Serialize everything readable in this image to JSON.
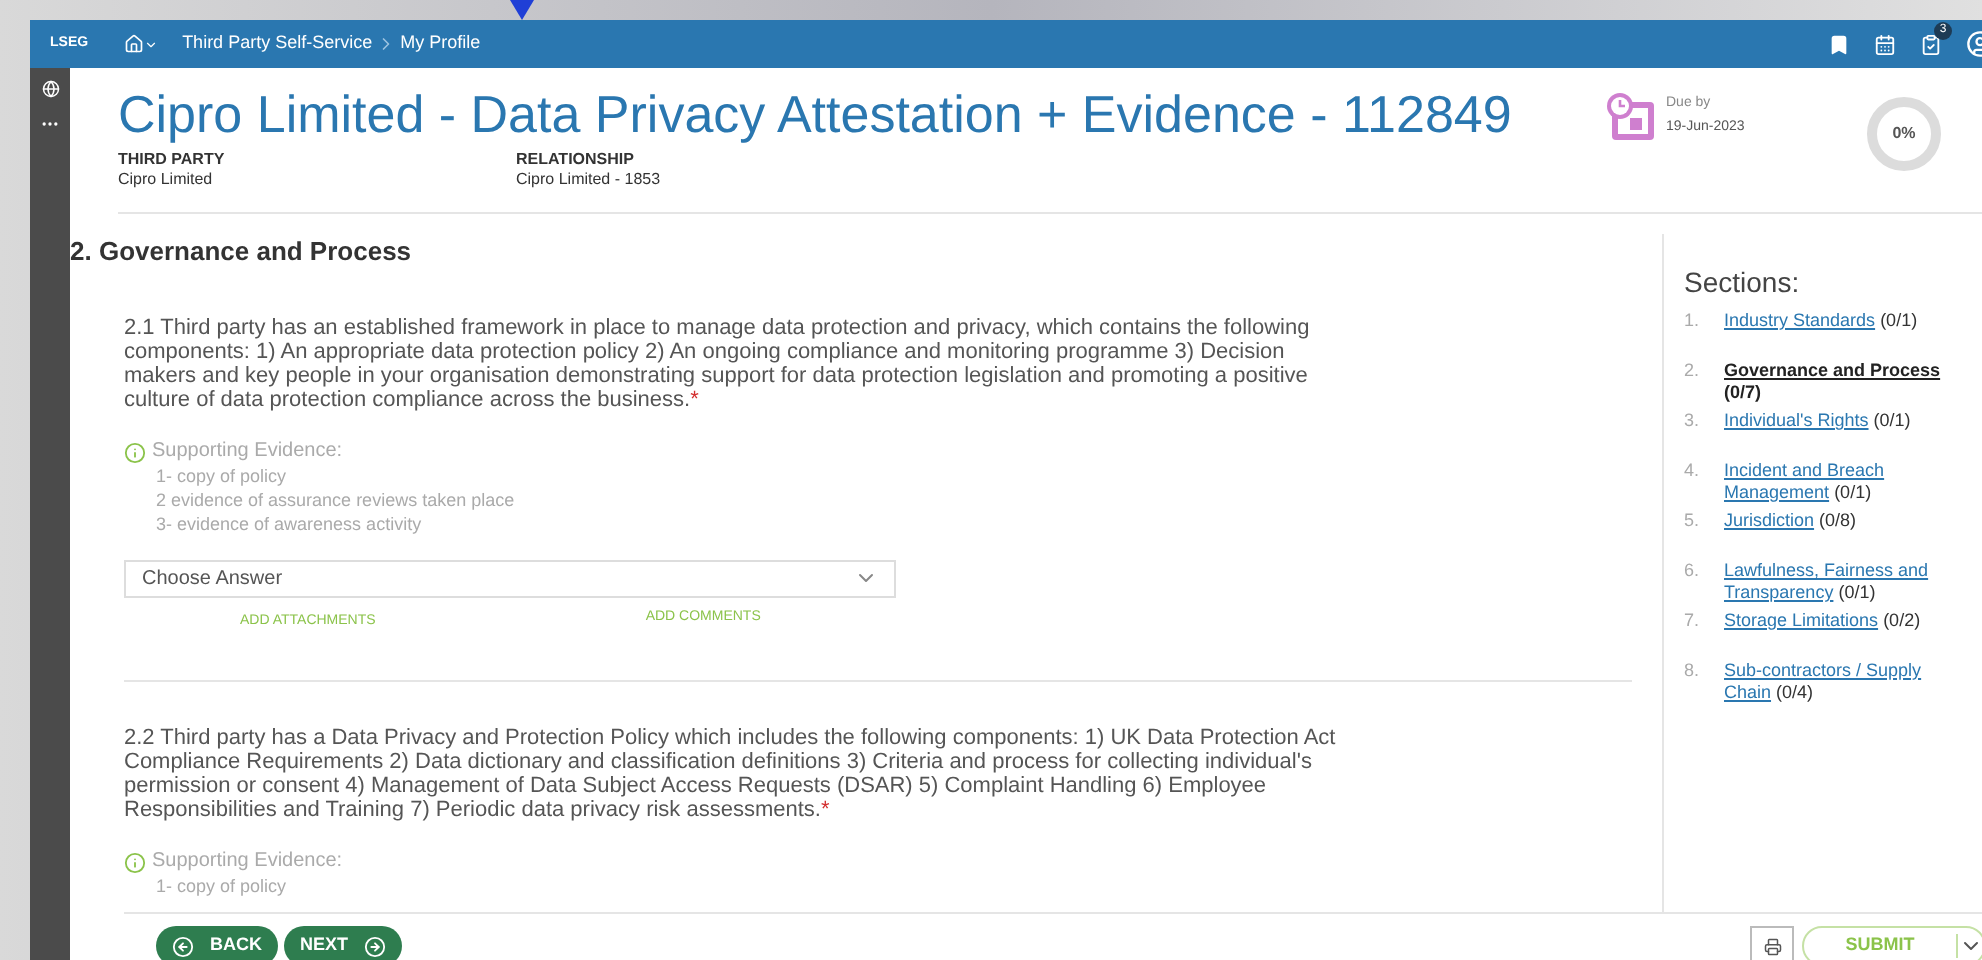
{
  "nav": {
    "logo": "LSEG",
    "breadcrumbs": [
      "Third Party Self-Service",
      "My Profile"
    ],
    "badge": "3"
  },
  "header": {
    "title": "Cipro Limited - Data Privacy Attestation + Evidence - 112849",
    "fields": [
      {
        "label": "THIRD PARTY",
        "value": "Cipro Limited"
      },
      {
        "label": "RELATIONSHIP",
        "value": "Cipro Limited - 1853"
      }
    ],
    "due_label": "Due by",
    "due_date": "19-Jun-2023",
    "progress": {
      "text": "0%",
      "level": 0
    }
  },
  "section_title": "2. Governance and Process",
  "questions": [
    {
      "text": "2.1 Third party has an established framework in place to manage data protection and privacy, which contains the following components: 1) An appropriate data protection policy 2) An ongoing compliance and monitoring programme 3) Decision makers and key people in your organisation demonstrating support for data protection legislation and promoting a positive culture of data protection compliance across the business.",
      "mark": "*",
      "evidence_title": "Supporting Evidence:",
      "evidence": [
        "1- copy of policy",
        "2 evidence of assurance reviews taken place",
        "3- evidence of awareness activity"
      ],
      "answer": {
        "placeholder": "Choose Answer"
      },
      "links": [
        "ADD ATTACHMENTS",
        "ADD COMMENTS"
      ]
    },
    {
      "text": "2.2 Third party has a Data Privacy and Protection Policy which includes the following components: 1) UK Data Protection Act Compliance Requirements 2) Data dictionary and classification definitions 3) Criteria and process for collecting individual's permission or consent 4) Management of Data Subject Access Requests (DSAR) 5) Complaint Handling 6) Employee Responsibilities and Training 7) Periodic data privacy risk assessments.",
      "mark": "*",
      "evidence_title": "Supporting Evidence:",
      "evidence": [
        "1- copy of policy"
      ]
    }
  ],
  "sections": {
    "title": "Sections:",
    "items": [
      {
        "number": "1.",
        "label": "Industry Standards",
        "count": "(0/1)",
        "selected": false
      },
      {
        "number": "2.",
        "label": "Governance and Process",
        "count": "(0/7)",
        "selected": true
      },
      {
        "number": "3.",
        "label": "Individual's Rights",
        "count": "(0/1)",
        "selected": false
      },
      {
        "number": "4.",
        "label": "Incident and Breach Management",
        "count": "(0/1)",
        "selected": false
      },
      {
        "number": "5.",
        "label": "Jurisdiction",
        "count": "(0/8)",
        "selected": false
      },
      {
        "number": "6.",
        "label": "Lawfulness, Fairness and Transparency",
        "count": "(0/1)",
        "selected": false
      },
      {
        "number": "7.",
        "label": "Storage Limitations",
        "count": "(0/2)",
        "selected": false
      },
      {
        "number": "8.",
        "label": "Sub-contractors / Supply Chain",
        "count": "(0/4)",
        "selected": false
      }
    ]
  },
  "footer": {
    "back": "BACK",
    "next": "NEXT",
    "submit": "SUBMIT"
  }
}
